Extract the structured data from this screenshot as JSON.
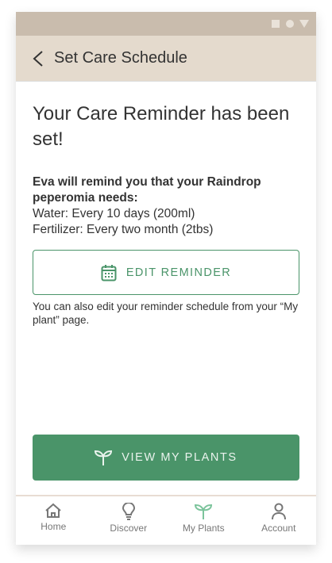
{
  "status_icons": [
    "square-icon",
    "circle-icon",
    "triangle-icon"
  ],
  "header": {
    "title": "Set Care Schedule"
  },
  "main": {
    "heading": "Your Care Reminder has been set!",
    "intro": "Eva will remind you that your Raindrop peperomia needs:",
    "water": "Water: Every 10 days (200ml)",
    "fertilizer": "Fertilizer: Every two month (2tbs)",
    "edit_label": "EDIT REMINDER",
    "hint": "You can also edit your reminder schedule from your  “My plant” page.",
    "view_label": "VIEW MY PLANTS"
  },
  "nav": {
    "items": [
      {
        "label": "Home"
      },
      {
        "label": "Discover"
      },
      {
        "label": "My Plants",
        "active": true
      },
      {
        "label": "Account"
      }
    ]
  },
  "colors": {
    "accent": "#4a9469",
    "active_nav": "#7cc49c",
    "header": "#e4dacd",
    "status": "#c9bcad"
  }
}
